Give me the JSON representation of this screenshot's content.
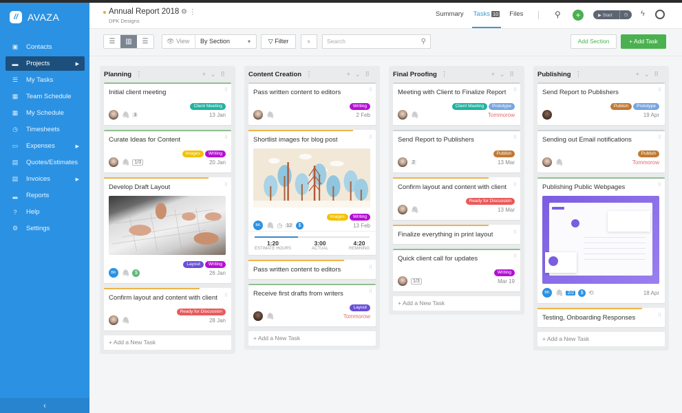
{
  "app": {
    "name": "AVAZA",
    "logo_icon": "avaza-logo-icon"
  },
  "sidebar": {
    "items": [
      {
        "label": "Contacts",
        "icon": "contacts-icon",
        "glyph": "▣",
        "active": false,
        "submenu": false
      },
      {
        "label": "Projects",
        "icon": "folder-icon",
        "glyph": "▬",
        "active": true,
        "submenu": true
      },
      {
        "label": "My Tasks",
        "icon": "task-list-icon",
        "glyph": "☰",
        "active": false,
        "submenu": false
      },
      {
        "label": "Team Schedule",
        "icon": "calendar-icon",
        "glyph": "▦",
        "active": false,
        "submenu": false
      },
      {
        "label": "My Schedule",
        "icon": "calendar-check-icon",
        "glyph": "▦",
        "active": false,
        "submenu": false
      },
      {
        "label": "Timesheets",
        "icon": "stopwatch-icon",
        "glyph": "◷",
        "active": false,
        "submenu": false
      },
      {
        "label": "Expenses",
        "icon": "expenses-icon",
        "glyph": "▭",
        "active": false,
        "submenu": true
      },
      {
        "label": "Quotes/Estimates",
        "icon": "quotes-icon",
        "glyph": "▤",
        "active": false,
        "submenu": false
      },
      {
        "label": "Invoices",
        "icon": "invoice-icon",
        "glyph": "▤",
        "active": false,
        "submenu": true
      },
      {
        "label": "Reports",
        "icon": "chart-icon",
        "glyph": "▂",
        "active": false,
        "submenu": false
      },
      {
        "label": "Help",
        "icon": "help-icon",
        "glyph": "?",
        "active": false,
        "submenu": false
      },
      {
        "label": "Settings",
        "icon": "gear-icon",
        "glyph": "⚙",
        "active": false,
        "submenu": false
      }
    ],
    "collapse_glyph": "‹"
  },
  "header": {
    "project_title": "Annual Report 2018",
    "project_client": "DPK Designs",
    "title_icons": "⚙ ⋮",
    "tabs": [
      {
        "label": "Summary",
        "active": false
      },
      {
        "label": "Tasks",
        "badge": "10",
        "active": true
      },
      {
        "label": "Files",
        "active": false
      }
    ],
    "timer_label": "▶ Start",
    "timer_clock_glyph": "◷",
    "plus_glyph": "+",
    "search_glyph": "⚲",
    "bolt_glyph": "ϟ"
  },
  "toolbar": {
    "view_toggles": [
      {
        "name": "list-view-button",
        "glyph": "☰",
        "active": false
      },
      {
        "name": "kanban-view-button",
        "glyph": "▥",
        "active": true
      },
      {
        "name": "gantt-view-button",
        "glyph": "☰",
        "active": false
      }
    ],
    "view_label": "View",
    "view_value": "By Section",
    "filter_label": "Filter",
    "expand_glyph": "»",
    "search_placeholder": "Search",
    "add_section_label": "Add Section",
    "add_task_label": "+ Add Task"
  },
  "tag_colors": {
    "Client Meeting": "#1fb3a0",
    "Images": "#f2c200",
    "Writing": "#b50fd4",
    "Layout": "#6a4fd8",
    "Ready for Discussion": "#ea5a5a",
    "Prototype": "#78a6e0",
    "Publish": "#c07a34"
  },
  "board": {
    "add_task_label": "+ Add a New Task",
    "columns": [
      {
        "title": "Planning",
        "cards": [
          {
            "title": "Initial client meeting",
            "tags": [
              "Client Meeting"
            ],
            "avatar": "photo",
            "attachment": true,
            "count": "3",
            "date": "13 Jan",
            "top": "green"
          },
          {
            "title": "Curate Ideas for Content",
            "tags": [
              "Images",
              "Writing"
            ],
            "avatar": "photo",
            "attachment": true,
            "checklist": "1/3",
            "date": "20 Jan",
            "top": "green"
          },
          {
            "title": "Develop Draft Layout",
            "cover": "architects-drawing",
            "tags": [
              "Layout",
              "Writing"
            ],
            "avatar": "BK",
            "attachment": true,
            "billable": true,
            "date": "26 Jan",
            "top": "orange"
          },
          {
            "title": "Confirm layout and content with client",
            "tags": [
              "Ready for Discussion"
            ],
            "avatar": "photo",
            "attachment": true,
            "date": "28 Jan",
            "top": "orange"
          }
        ]
      },
      {
        "title": "Content Creation",
        "cards": [
          {
            "title": "Pass written content to editors",
            "tags": [
              "Writing"
            ],
            "avatar": "photo",
            "attachment": true,
            "date": "2 Feb",
            "top": "gray"
          },
          {
            "title": "Shortlist images for blog post",
            "cover": "forest-illustration",
            "tags": [
              "Images",
              "Writing"
            ],
            "avatar": "BK",
            "attachment": true,
            "clock": true,
            "count": "12",
            "billable": true,
            "date": "13 Feb",
            "top": "orange",
            "time": {
              "estimate": "1:20",
              "estimate_label": "ESTIMATE HOURS",
              "actual": "3:00",
              "actual_label": "ACTUAL",
              "remaining": "4:20",
              "remaining_label": "REMINING",
              "progress": 0.38
            }
          },
          {
            "title": "Pass written content to editors",
            "top": "orange"
          },
          {
            "title": "Receive first drafts from writers",
            "tags": [
              "Layout"
            ],
            "avatar": "dark",
            "attachment": true,
            "date": "Tommorow",
            "date_red": true,
            "top": "green"
          }
        ]
      },
      {
        "title": "Final Proofing",
        "cards": [
          {
            "title": "Meeting with Client to Finalize Report",
            "tags": [
              "Client Meeting",
              "Prototype"
            ],
            "avatar": "photo",
            "attachment": true,
            "date": "Tommorow",
            "date_red": true,
            "top": "gray"
          },
          {
            "title": "Send Report to Publishers",
            "tags": [
              "Publish"
            ],
            "avatar": "photo",
            "count": "2",
            "date": "13 Mar",
            "top": "gray"
          },
          {
            "title": "Confirm layout and content with client",
            "tags": [
              "Ready for Discussion"
            ],
            "avatar": "photo",
            "attachment": true,
            "date": "13 Mar",
            "top": "orange"
          },
          {
            "title": "Finalize everything in print layout",
            "top": "orange"
          },
          {
            "title": "Quick client call for updates",
            "tags": [
              "Writing"
            ],
            "avatar": "photo",
            "checklist": "1/3",
            "date": "Mar 19",
            "top": "green"
          }
        ]
      },
      {
        "title": "Publishing",
        "cards": [
          {
            "title": "Send Report to Publishers",
            "tags": [
              "Publish",
              "Prototype"
            ],
            "avatar": "dark",
            "date": "19 Apr",
            "top": "gray"
          },
          {
            "title": "Sending out Email notifications",
            "tags": [
              "Publish"
            ],
            "avatar": "photo",
            "attachment": true,
            "date": "Tommorow",
            "date_red": true,
            "top": "gray"
          },
          {
            "title": "Publishing Public Webpages",
            "cover": "dashboard-screenshot",
            "avatar": "BK",
            "attachment": true,
            "checklist_blue": "2/2",
            "billable": true,
            "recurring": true,
            "date": "18 Apr",
            "top": "green"
          },
          {
            "title": "Testing, Onboarding Responses",
            "top": "orange"
          }
        ]
      }
    ]
  }
}
